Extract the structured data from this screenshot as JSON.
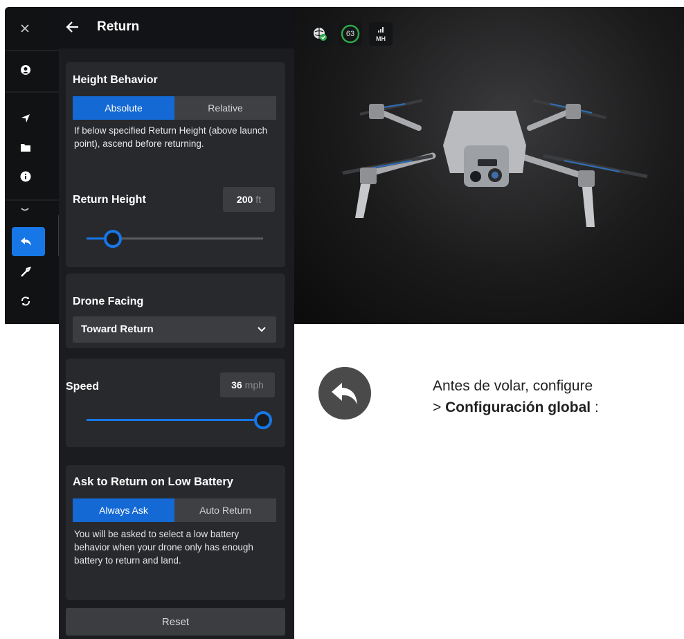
{
  "panel": {
    "title": "Return",
    "height_behavior": {
      "title": "Height Behavior",
      "options": [
        "Absolute",
        "Relative"
      ],
      "selected": "Absolute",
      "description": "If below specified Return Height (above launch point), ascend before returning."
    },
    "return_height": {
      "label": "Return Height",
      "value": "200",
      "unit": "ft",
      "slider_fraction": 0.15
    },
    "drone_facing": {
      "label": "Drone Facing",
      "value": "Toward Return"
    },
    "speed": {
      "label": "Speed",
      "value": "36",
      "unit": "mph",
      "slider_fraction": 1.0
    },
    "low_battery": {
      "title": "Ask to Return on Low Battery",
      "options": [
        "Always Ask",
        "Auto Return"
      ],
      "selected": "Always Ask",
      "description": "You will be asked to select a low battery behavior when your drone only has enough battery to return and land."
    },
    "reset_label": "Reset"
  },
  "status": {
    "battery": "63",
    "signal_label": "MH"
  },
  "tip": {
    "line1": "Antes de volar, configure",
    "line2_prefix": ">",
    "line2_bold": "Configuración global",
    "line2_suffix": ":"
  },
  "colors": {
    "accent": "#1877e6",
    "panel_bg": "#1b1c1f",
    "card_bg": "#28292d"
  }
}
